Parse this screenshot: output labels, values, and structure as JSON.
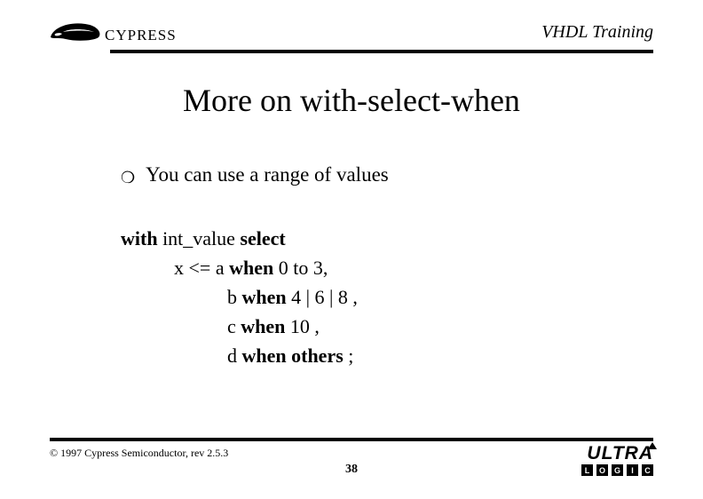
{
  "header": {
    "logo_text": "CYPRESS",
    "title": "VHDL Training"
  },
  "slide": {
    "title": "More on with-select-when",
    "bullet_mark": "❍",
    "bullet_text": "You can use a range of values",
    "code": {
      "l1_a": "with ",
      "l1_b": "int_value ",
      "l1_c": "select",
      "l2_a": "x <=  a ",
      "l2_b": "when ",
      "l2_c": "0 to 3,",
      "l3_a": "b ",
      "l3_b": "when ",
      "l3_c": "4 | 6 | 8 ,",
      "l4_a": "c ",
      "l4_b": "when ",
      "l4_c": "10 ,",
      "l5_a": "d ",
      "l5_b": "when ",
      "l5_c": "others ",
      "l5_d": ";"
    }
  },
  "footer": {
    "copyright": "© 1997 Cypress Semiconductor, rev 2.5.3",
    "page_number": "38",
    "ultra_word": "ULTRA",
    "ultra_sub": [
      "L",
      "O",
      "G",
      "I",
      "C"
    ]
  }
}
